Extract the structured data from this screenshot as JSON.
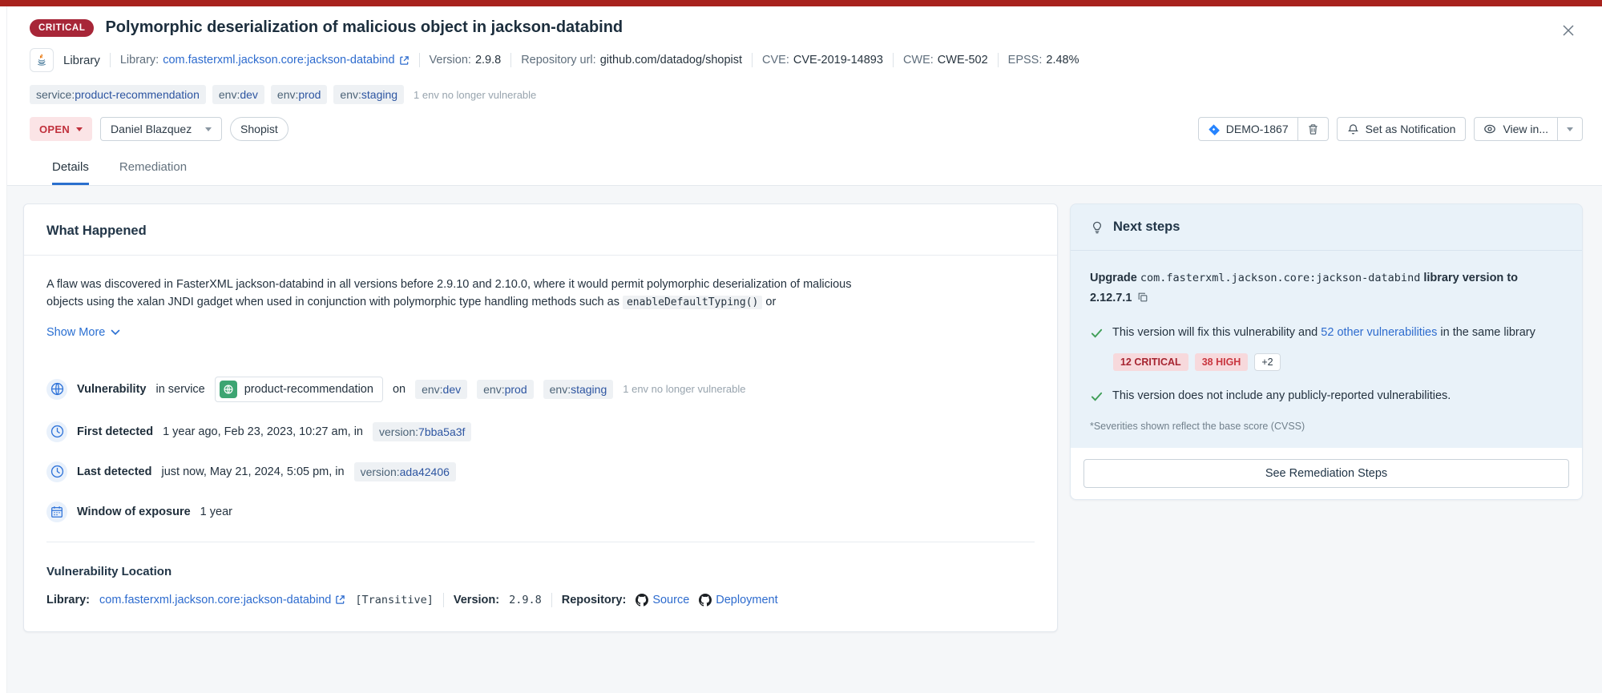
{
  "colors": {
    "top_bar": "#a8231d",
    "critical_badge_bg": "#a72638",
    "link_blue": "#2d6bce",
    "tab_active_underline": "#2a6fce",
    "open_button_bg": "#fbe4e6",
    "open_button_text": "#c0303c",
    "tag_bg": "#eef1f4",
    "next_steps_bg": "#e9f2f9",
    "severity_badge_bg": "#f7d9dc",
    "severity_critical_text": "#a62430",
    "severity_high_text": "#c9363f",
    "check_green": "#3f9e57",
    "service_icon_green": "#3da572"
  },
  "icons": {
    "close": "close-icon",
    "java": "java-icon",
    "external_link": "external-link-icon",
    "jira": "jira-icon",
    "trash": "trash-icon",
    "bell": "bell-icon",
    "eye": "eye-icon",
    "caret_down": "chevron-down-icon",
    "globe": "globe-icon",
    "clock": "clock-icon",
    "calendar": "calendar-icon",
    "lightbulb": "lightbulb-icon",
    "check": "check-icon",
    "copy": "copy-icon",
    "github": "github-icon"
  },
  "header": {
    "severity": "CRITICAL",
    "title": "Polymorphic deserialization of malicious object in jackson-databind",
    "type_label": "Library",
    "meta": {
      "library_label": "Library:",
      "library_value": "com.fasterxml.jackson.core:jackson-databind",
      "version_label": "Version:",
      "version_value": "2.9.8",
      "repository_label": "Repository url:",
      "repository_value": "github.com/datadog/shopist",
      "cve_label": "CVE:",
      "cve_value": "CVE-2019-14893",
      "cwe_label": "CWE:",
      "cwe_value": "CWE-502",
      "epss_label": "EPSS:",
      "epss_value": "2.48%"
    },
    "tags": [
      {
        "key": "service:",
        "value": "product-recommendation"
      },
      {
        "key": "env:",
        "value": "dev"
      },
      {
        "key": "env:",
        "value": "prod"
      },
      {
        "key": "env:",
        "value": "staging"
      }
    ],
    "tags_note": "1 env no longer vulnerable",
    "actions": {
      "status": "OPEN",
      "assignee": "Daniel Blazquez",
      "team": "Shopist",
      "ticket": "DEMO-1867",
      "notification": "Set as Notification",
      "view_in": "View in..."
    }
  },
  "tabs": {
    "details": "Details",
    "remediation": "Remediation"
  },
  "what_happened": {
    "title": "What Happened",
    "desc_pre": "A flaw was discovered in FasterXML jackson-databind in all versions before 2.9.10 and 2.10.0, where it would permit polymorphic deserialization of malicious objects using the xalan JNDI gadget when used in conjunction with polymorphic type handling methods such as ",
    "desc_code": "enableDefaultTyping()",
    "desc_post": " or",
    "show_more": "Show More",
    "service_row": {
      "label": "Vulnerability",
      "mid": "in service",
      "service": "product-recommendation",
      "on": "on",
      "envs": [
        {
          "key": "env:",
          "value": "dev"
        },
        {
          "key": "env:",
          "value": "prod"
        },
        {
          "key": "env:",
          "value": "staging"
        }
      ],
      "note": "1 env no longer vulnerable"
    },
    "first_detected": {
      "label": "First detected",
      "text": "1 year ago, Feb 23, 2023, 10:27 am, in",
      "tag_key": "version:",
      "tag_value": "7bba5a3f"
    },
    "last_detected": {
      "label": "Last detected",
      "text": "just now, May 21, 2024, 5:05 pm, in",
      "tag_key": "version:",
      "tag_value": "ada42406"
    },
    "window": {
      "label": "Window of exposure",
      "text": "1 year"
    },
    "location": {
      "title": "Vulnerability Location",
      "library_label": "Library:",
      "library_link": "com.fasterxml.jackson.core:jackson-databind",
      "transitive": "[Transitive]",
      "version_label": "Version:",
      "version_value": "2.9.8",
      "repository_label": "Repository:",
      "source_link": "Source",
      "deployment_link": "Deployment"
    }
  },
  "next_steps": {
    "title": "Next steps",
    "upgrade_lead": "Upgrade ",
    "upgrade_code": "com.fasterxml.jackson.core:jackson-databind",
    "upgrade_rest": " library version to 2.12.7.1",
    "fix_pre": "This version will fix this vulnerability and ",
    "fix_link": "52 other vulnerabilities",
    "fix_post": " in the same library",
    "badges": [
      {
        "label": "12 CRITICAL",
        "type": "critical"
      },
      {
        "label": "38 HIGH",
        "type": "high"
      },
      {
        "label": "+2",
        "type": "more"
      }
    ],
    "no_vulns": "This version does not include any publicly-reported vulnerabilities.",
    "footnote": "*Severities shown reflect the base score (CVSS)",
    "cta": "See Remediation Steps"
  }
}
